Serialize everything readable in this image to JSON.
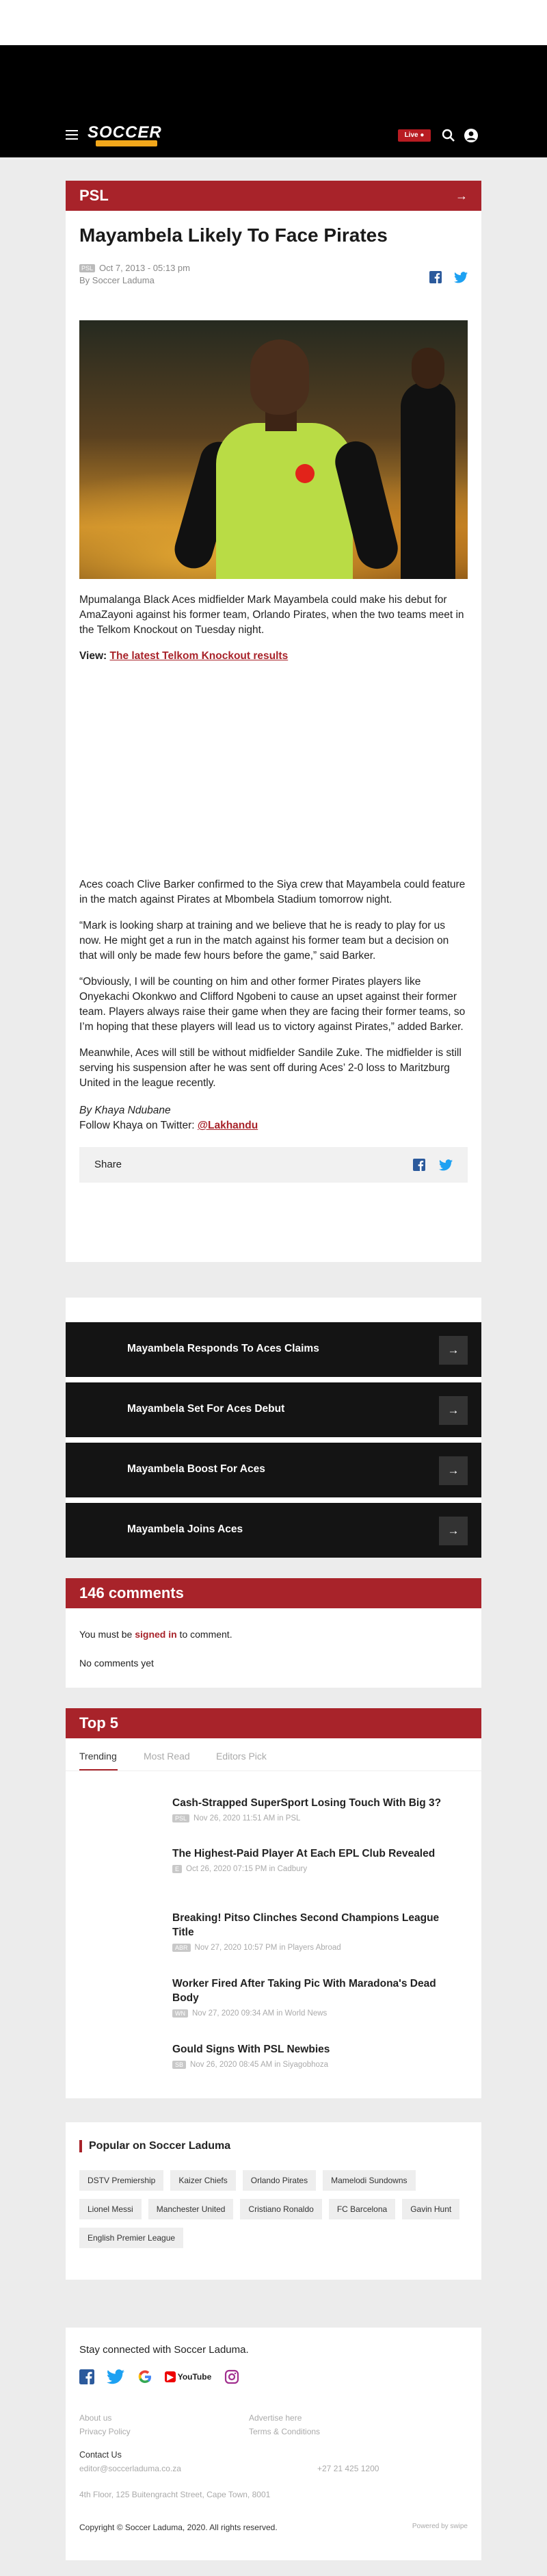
{
  "header": {
    "logo_main": "SOCCER",
    "live_label": "Live ●"
  },
  "article": {
    "section": "PSL",
    "title": "Mayambela Likely To Face Pirates",
    "date_tag": "PSL",
    "date": "Oct 7, 2013 - 05:13 pm",
    "author": "By Soccer Laduma",
    "p1": "Mpumalanga Black Aces midfielder Mark Mayambela could make his debut for AmaZayoni against his former team, Orlando Pirates, when the two teams meet in the Telkom Knockout on Tuesday night.",
    "view_label": "View:",
    "view_link": "The latest Telkom Knockout results",
    "p2": "Aces coach Clive Barker confirmed to the Siya crew that Mayambela could feature in the match against Pirates at Mbombela Stadium tomorrow night.",
    "p3": "“Mark is looking sharp at training and we believe that he is ready to play for us now. He might get a run in the match against his former team but a decision on that will only be made few hours before the game,” said Barker.",
    "p4": "“Obviously, I will be counting on him and other former Pirates players like Onyekachi Okonkwo and Clifford Ngobeni to cause an upset against their former team. Players always raise their game when they are facing their former teams, so I’m hoping that these players will lead us to victory against Pirates,” added Barker.",
    "p5": "Meanwhile, Aces will still be without midfielder Sandile Zuke. The midfielder is still serving his suspension after he was sent off during Aces’ 2-0 loss to Maritzburg United in the league recently.",
    "byline": "By Khaya Ndubane",
    "follow_prefix": "Follow Khaya on Twitter: ",
    "twitter_handle": "@Lakhandu",
    "share_label": "Share"
  },
  "related": [
    {
      "title": "Mayambela Responds To Aces Claims"
    },
    {
      "title": "Mayambela Set For Aces Debut"
    },
    {
      "title": "Mayambela Boost For Aces"
    },
    {
      "title": "Mayambela Joins Aces"
    }
  ],
  "comments": {
    "heading": "146 comments",
    "must_be": "You must be ",
    "signed_in": "signed in",
    "to_comment": " to comment.",
    "none": "No comments yet"
  },
  "top5": {
    "heading": "Top 5",
    "tabs": [
      "Trending",
      "Most Read",
      "Editors Pick"
    ],
    "items": [
      {
        "title": "Cash-Strapped SuperSport Losing Touch With Big 3?",
        "tag": "PSL",
        "meta": "Nov 26, 2020 11:51 AM in PSL"
      },
      {
        "title": "The Highest-Paid Player At Each EPL Club Revealed",
        "tag": "E",
        "meta": "Oct 26, 2020 07:15 PM in Cadbury"
      },
      {
        "title": "Breaking! Pitso Clinches Second Champions League Title",
        "tag": "ABR",
        "meta": "Nov 27, 2020 10:57 PM in Players Abroad"
      },
      {
        "title": "Worker Fired After Taking Pic With Maradona's Dead Body",
        "tag": "WN",
        "meta": "Nov 27, 2020 09:34 AM in World News"
      },
      {
        "title": "Gould Signs With PSL Newbies",
        "tag": "SB",
        "meta": "Nov 26, 2020 08:45 AM in Siyagobhoza"
      }
    ]
  },
  "popular": {
    "heading": "Popular on Soccer Laduma",
    "chips": [
      "DSTV Premiership",
      "Kaizer Chiefs",
      "Orlando Pirates",
      "Mamelodi Sundowns",
      "Lionel Messi",
      "Manchester United",
      "Cristiano Ronaldo",
      "FC Barcelona",
      "Gavin Hunt",
      "English Premier League"
    ]
  },
  "footer": {
    "stay": "Stay connected with Soccer Laduma.",
    "youtube": "YouTube",
    "about": "About us",
    "privacy": "Privacy Policy",
    "advertise": "Advertise here",
    "terms": "Terms & Conditions",
    "contact_heading": "Contact Us",
    "email": "editor@soccerladuma.co.za",
    "phone": "+27 21 425 1200",
    "address": "4th Floor, 125 Buitengracht Street, Cape Town, 8001",
    "copyright": "Copyright © Soccer Laduma, 2020. All rights reserved.",
    "powered": "Powered by swipe"
  },
  "colors": {
    "brand_red": "#a8232a",
    "dark": "#141414"
  }
}
